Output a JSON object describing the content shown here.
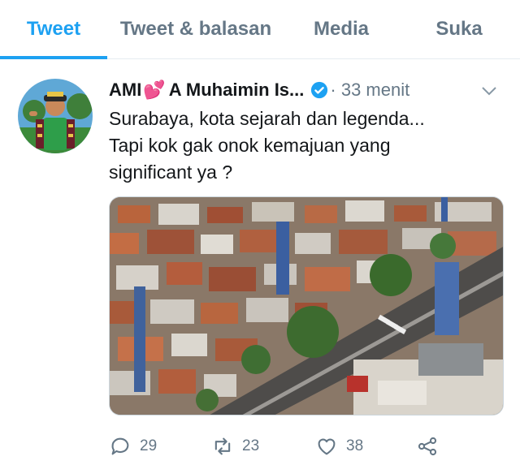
{
  "tabs": [
    {
      "label": "Tweet"
    },
    {
      "label": "Tweet & balasan"
    },
    {
      "label": "Media"
    },
    {
      "label": "Suka"
    }
  ],
  "active_tab": 0,
  "tweet": {
    "author_name": "AMI",
    "author_name_rest": "A Muhaimin Is...",
    "time": "· 33 menit",
    "lines": [
      "Surabaya, kota sejarah dan legenda...",
      "Tapi kok gak onok kemajuan yang",
      "significant ya ?"
    ],
    "replies": "29",
    "retweets": "23",
    "likes": "38"
  },
  "colors": {
    "accent": "#1da1f2",
    "muted": "#657786",
    "heart": "#e0245e"
  },
  "icons": [
    "verified-badge-icon",
    "chevron-down-icon",
    "reply-icon",
    "retweet-icon",
    "like-icon",
    "share-icon"
  ]
}
